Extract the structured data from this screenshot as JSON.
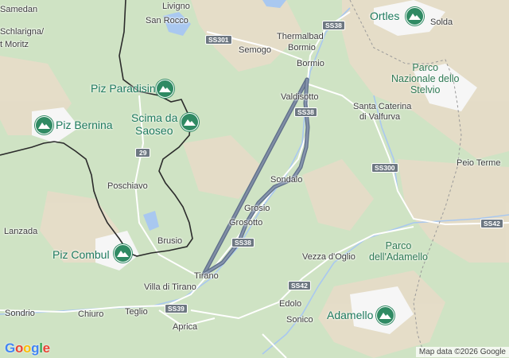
{
  "map": {
    "colors": {
      "land": "#cfe3c4",
      "mountain": "#e6dcc8",
      "water": "#a9c8f0",
      "route": "#5e6e88",
      "border": "#2b2b2b",
      "peak_green": "#2f8a63"
    },
    "places": {
      "samedan": "Samedan",
      "schlarigna": "Schlarigna/",
      "st_moritz": "t Moritz",
      "livigno": "Livigno",
      "san_rocco": "San Rocco",
      "semogo": "Semogo",
      "thermalbad_bormio": "Thermalbad",
      "bormio": "Bormio",
      "bormio2": "Bormio",
      "valdisotto": "Valdisotto",
      "santa_caterina": "Santa Caterina",
      "valfurva": "di Valfurva",
      "solda": "Solda",
      "poschiavo": "Poschiavo",
      "lanzada": "Lanzada",
      "sondalo": "Sondalo",
      "grosio": "Grosio",
      "grosotto": "Grosotto",
      "brusio": "Brusio",
      "tirano": "Tirano",
      "villa_di_tirano": "Villa di Tirano",
      "vezza": "Vezza d'Oglio",
      "sondrio": "Sondrio",
      "chiuro": "Chiuro",
      "teglio": "Teglio",
      "edolo": "Edolo",
      "sonico": "Sonico",
      "aprica": "Aprica",
      "peio_terme": "Peio Terme"
    },
    "peaks": {
      "ortles": "Ortles",
      "piz_paradisin": "Piz Paradisin",
      "scima_1": "Scima da",
      "scima_2": "Saoseo",
      "piz_bernina": "Piz Bernina",
      "piz_combul": "Piz Combul",
      "adamello": "Adamello"
    },
    "parks": {
      "stelvio_1": "Parco",
      "stelvio_2": "Nazionale dello",
      "stelvio_3": "Stelvio",
      "adamello_1": "Parco",
      "adamello_2": "dell'Adamello"
    },
    "roads": {
      "ss301": "SS301",
      "ss38_top": "SS38",
      "ss38_mid": "SS38",
      "ss38_low": "SS38",
      "r29": "29",
      "ss300": "SS300",
      "ss42_right": "SS42",
      "ss42_mid": "SS42",
      "ss39": "SS39"
    },
    "google_logo": {
      "letters": [
        "G",
        "o",
        "o",
        "g",
        "l",
        "e"
      ],
      "colors": [
        "#4285F4",
        "#EA4335",
        "#FBBC05",
        "#4285F4",
        "#34A853",
        "#EA4335"
      ]
    },
    "attribution": "Map data ©2026 Google"
  }
}
